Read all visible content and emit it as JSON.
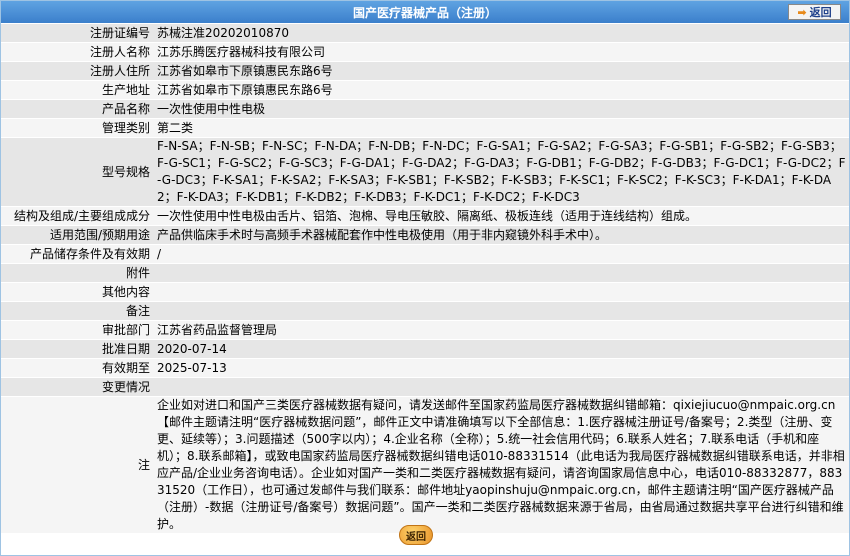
{
  "header": {
    "title": "国产医疗器械产品（注册）",
    "back_label": "返回"
  },
  "rows": [
    {
      "label": "注册证编号",
      "value": "苏械注准20202010870"
    },
    {
      "label": "注册人名称",
      "value": "江苏乐腾医疗器械科技有限公司"
    },
    {
      "label": "注册人住所",
      "value": "江苏省如皋市下原镇惠民东路6号"
    },
    {
      "label": "生产地址",
      "value": "江苏省如皋市下原镇惠民东路6号"
    },
    {
      "label": "产品名称",
      "value": "一次性使用中性电极"
    },
    {
      "label": "管理类别",
      "value": "第二类"
    },
    {
      "label": "型号规格",
      "value": "F-N-SA；F-N-SB；F-N-SC；F-N-DA；F-N-DB；F-N-DC；F-G-SA1；F-G-SA2；F-G-SA3；F-G-SB1；F-G-SB2；F-G-SB3；F-G-SC1；F-G-SC2；F-G-SC3；F-G-DA1；F-G-DA2；F-G-DA3；F-G-DB1；F-G-DB2；F-G-DB3；F-G-DC1；F-G-DC2；F-G-DC3；F-K-SA1；F-K-SA2；F-K-SA3；F-K-SB1；F-K-SB2；F-K-SB3；F-K-SC1；F-K-SC2；F-K-SC3；F-K-DA1；F-K-DA2；F-K-DA3；F-K-DB1；F-K-DB2；F-K-DB3；F-K-DC1；F-K-DC2；F-K-DC3"
    },
    {
      "label": "结构及组成/主要组成成分",
      "value": "一次性使用中性电极由舌片、铝箔、泡棉、导电压敏胶、隔离纸、极板连线（适用于连线结构）组成。"
    },
    {
      "label": "适用范围/预期用途",
      "value": "产品供临床手术时与高频手术器械配套作中性电极使用（用于非内窥镜外科手术中）。"
    },
    {
      "label": "产品储存条件及有效期",
      "value": "/"
    },
    {
      "label": "附件",
      "value": ""
    },
    {
      "label": "其他内容",
      "value": ""
    },
    {
      "label": "备注",
      "value": ""
    },
    {
      "label": "审批部门",
      "value": "江苏省药品监督管理局"
    },
    {
      "label": "批准日期",
      "value": "2020-07-14"
    },
    {
      "label": "有效期至",
      "value": "2025-07-13"
    },
    {
      "label": "变更情况",
      "value": ""
    }
  ],
  "note": {
    "label": "注",
    "text": "企业如对进口和国产三类医疗器械数据有疑问，请发送邮件至国家药监局医疗器械数据纠错邮箱：qixiejiucuo@nmpaic.org.cn【邮件主题请注明“医疗器械数据问题”，邮件正文中请准确填写以下全部信息：1.医疗器械注册证号/备案号；2.类型（注册、变更、延续等）；3.问题描述（500字以内）；4.企业名称（全称）；5.统一社会信用代码；6.联系人姓名；7.联系电话（手机和座机）；8.联系邮箱】，或致电国家药监局医疗器械数据纠错电话010-88331514（此电话为我局医疗器械数据纠错联系电话，并非相应产品/企业业务咨询电话）。企业如对国产一类和二类医疗器械数据有疑问，请咨询国家局信息中心，电话010-88332877，88331520（工作日），也可通过发邮件与我们联系：邮件地址yaopinshuju@nmpaic.org.cn，邮件主题请注明“国产医疗器械产品（注册）-数据（注册证号/备案号）数据问题”。国产一类和二类医疗器械数据来源于省局，由省局通过数据共享平台进行纠错和维护。"
  }
}
